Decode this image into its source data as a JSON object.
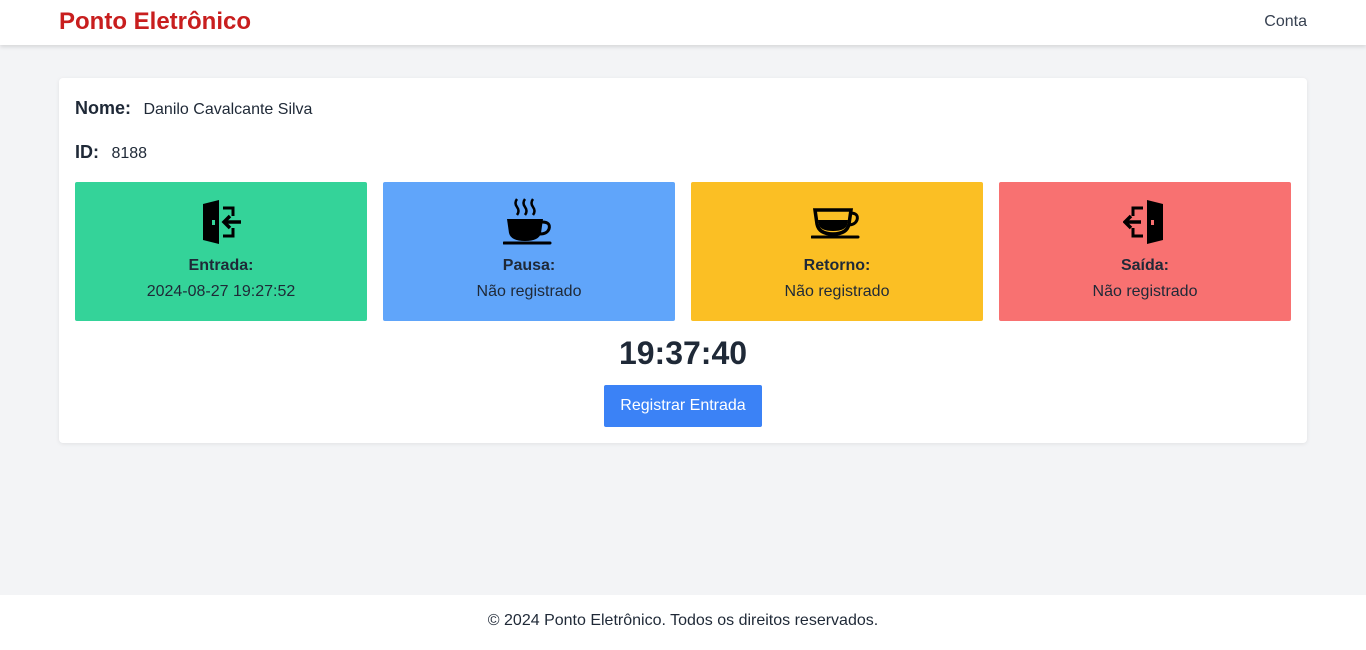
{
  "header": {
    "brand": "Ponto Eletrônico",
    "account_link": "Conta"
  },
  "employee": {
    "name_label": "Nome:",
    "name": "Danilo Cavalcante Silva",
    "id_label": "ID:",
    "id": "8188"
  },
  "tiles": [
    {
      "label": "Entrada:",
      "value": "2024-08-27 19:27:52",
      "color": "#34d399",
      "icon": "door-enter-icon"
    },
    {
      "label": "Pausa:",
      "value": "Não registrado",
      "color": "#60a5fa",
      "icon": "hot-coffee-icon"
    },
    {
      "label": "Retorno:",
      "value": "Não registrado",
      "color": "#fbbf24",
      "icon": "coffee-cup-icon"
    },
    {
      "label": "Saída:",
      "value": "Não registrado",
      "color": "#f87171",
      "icon": "door-exit-icon"
    }
  ],
  "clock": "19:37:40",
  "action_button": "Registrar Entrada",
  "footer": "© 2024 Ponto Eletrônico. Todos os direitos reservados."
}
